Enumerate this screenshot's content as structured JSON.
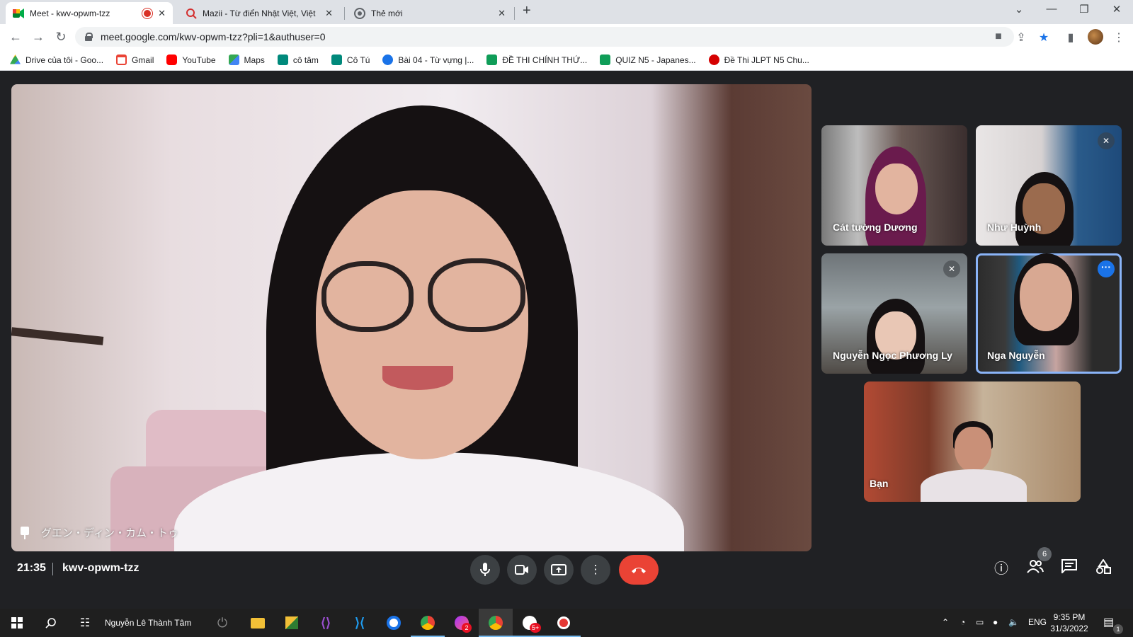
{
  "browser": {
    "tabs": [
      {
        "title": "Meet - kwv-opwm-tzz",
        "recording": true,
        "active": true
      },
      {
        "title": "Mazii - Từ điển Nhật Việt, Việt Nhật"
      },
      {
        "title": "Thẻ mới"
      }
    ],
    "new_tab_label": "+",
    "url": "meet.google.com/kwv-opwm-tzz?pli=1&authuser=0",
    "bookmarks": [
      {
        "label": "Drive của tôi - Goo...",
        "color": "#34a853"
      },
      {
        "label": "Gmail",
        "color": "#ea4335"
      },
      {
        "label": "YouTube",
        "color": "#ff0000"
      },
      {
        "label": "Maps",
        "color": "#34a853"
      },
      {
        "label": "cô tâm",
        "color": "#00897b"
      },
      {
        "label": "Cô Tú",
        "color": "#00897b"
      },
      {
        "label": "Bài 04 - Từ vựng |...",
        "color": "#1a73e8"
      },
      {
        "label": "ĐỀ THI CHÍNH THỨ...",
        "color": "#0f9d58"
      },
      {
        "label": "QUIZ N5 - Japanes...",
        "color": "#0f9d58"
      },
      {
        "label": "Đề Thi JLPT N5 Chu...",
        "color": "#d50000"
      }
    ]
  },
  "meet": {
    "main_participant": "グエン・ディン・カム・トゥ",
    "participants": [
      {
        "name": "Cát tường Dương",
        "muted": false
      },
      {
        "name": "Như Huỳnh",
        "muted": true
      },
      {
        "name": "Nguyễn Ngọc Phương Ly",
        "muted": true
      },
      {
        "name": "Nga Nguyễn",
        "muted": false,
        "highlighted": true
      },
      {
        "name": "Bạn",
        "muted": false
      }
    ],
    "time": "21:35",
    "meeting_code": "kwv-opwm-tzz",
    "people_count": "6"
  },
  "taskbar": {
    "user_label": "Nguyễn Lê Thành Tâm",
    "language": "ENG",
    "time": "9:35 PM",
    "date": "31/3/2022",
    "notification_count": "1",
    "zalo_badge": "5+",
    "messenger_badge": "2"
  },
  "colors": {
    "meet_bg": "#202124",
    "control_bg": "#3c4043",
    "end_call": "#ea4335",
    "highlight": "#8ab4f8",
    "accent": "#1a73e8"
  }
}
